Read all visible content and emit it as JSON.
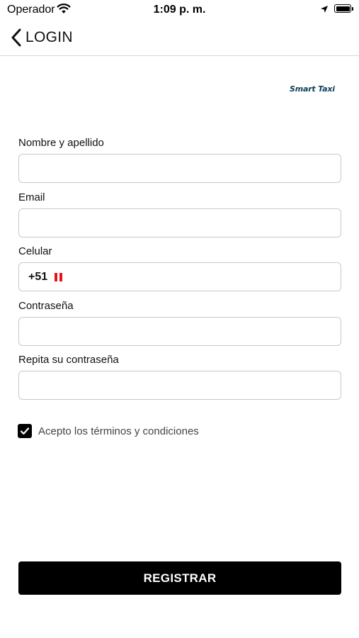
{
  "status_bar": {
    "carrier": "Operador",
    "time": "1:09 p. m.",
    "wifi_icon": "wifi-icon",
    "location_icon": "location-arrow-icon",
    "battery_icon": "battery-icon"
  },
  "nav": {
    "back_label": "LOGIN",
    "back_icon": "chevron-left-icon"
  },
  "logo": {
    "text": "Smart Taxi",
    "color": "#10405a"
  },
  "form": {
    "fields": [
      {
        "label": "Nombre y apellido",
        "value": "",
        "placeholder": ""
      },
      {
        "label": "Email",
        "value": "",
        "placeholder": ""
      },
      {
        "label": "Celular",
        "country_code": "+51",
        "flag": "peru-flag-icon",
        "value": ""
      },
      {
        "label": "Contraseña",
        "value": "",
        "placeholder": ""
      },
      {
        "label": "Repita su contraseña",
        "value": "",
        "placeholder": ""
      }
    ]
  },
  "terms": {
    "checked": true,
    "label": "Acepto los términos y condiciones"
  },
  "register_button": {
    "label": "REGISTRAR",
    "background": "#000000"
  }
}
